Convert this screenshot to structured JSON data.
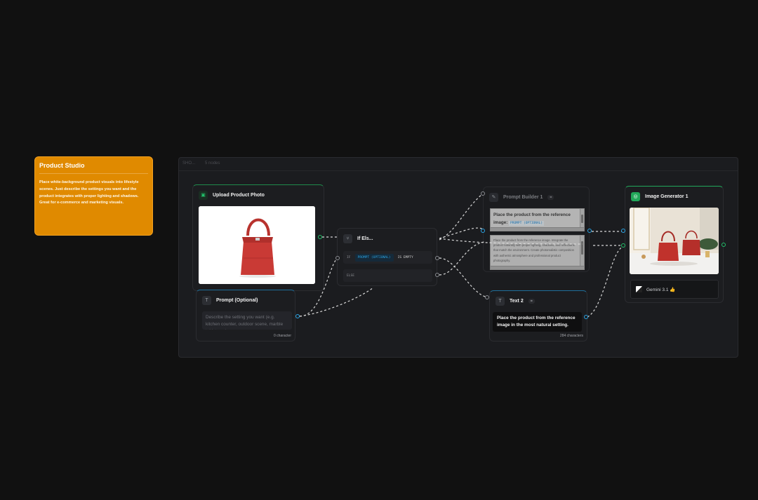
{
  "note": {
    "title": "Product Studio",
    "body": "Place white-background product visuals into lifestyle scenes. Just describe the settings you want and the product integrates with proper lighting and shadows. Great for e-commerce and marketing visuals."
  },
  "group": {
    "label": "SHO...",
    "meta": "5 nodes"
  },
  "nodes": {
    "upload": {
      "title": "Upload Product Photo",
      "icon": "image-icon"
    },
    "prompt": {
      "title": "Prompt (Optional)",
      "placeholder": "Describe the setting you want (e.g. kitchen counter, outdoor scene, marble tabletop...)",
      "count": "0 character"
    },
    "ifelse": {
      "title": "If Els...",
      "if_kw": "IF",
      "if_var": "PROMPT (OPTIONAL)",
      "if_op": "IS EMPTY",
      "else_kw": "ELSE"
    },
    "builder": {
      "title": "Prompt Builder 1",
      "line1": "Place the product from the reference image:",
      "line1_tag": "PROMPT (OPTIONAL)",
      "line2": "Place the product from the reference image. Integrate the product naturally with proper lighting, shadows, and reflections that match the environment. Create photorealistic composition with authentic atmosphere and professional product photography."
    },
    "text2": {
      "title": "Text 2",
      "value": "Place the product from the reference image in the most natural setting.",
      "count": "284 characters"
    },
    "generator": {
      "title": "Image Generator 1",
      "model": "Gemini 3.1 👍"
    }
  },
  "colors": {
    "note_bg": "#e08a00",
    "accent_green": "#22c06a",
    "accent_blue": "#2aa5e6"
  }
}
